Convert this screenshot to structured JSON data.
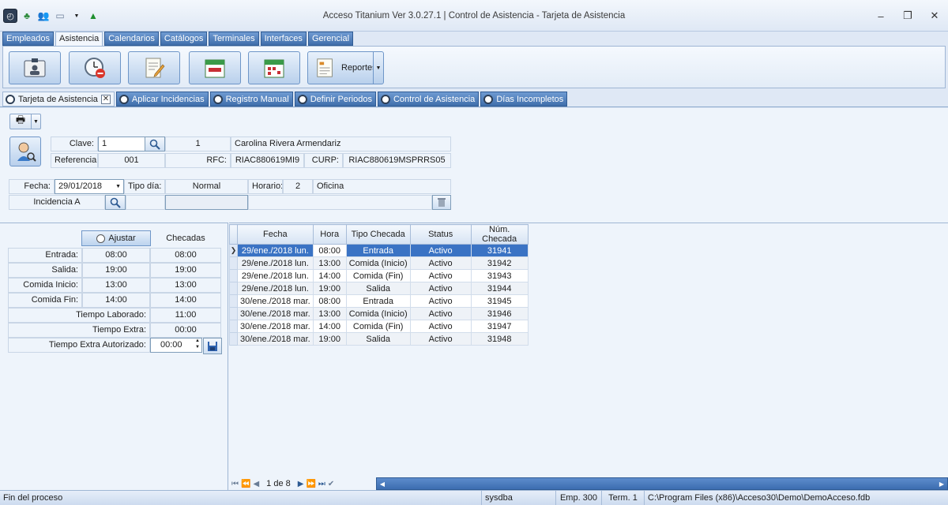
{
  "window": {
    "title": "Acceso Titanium  Ver 3.0.27.1 | Control de Asistencia - Tarjeta de Asistencia"
  },
  "main_tabs": [
    "Empleados",
    "Asistencia",
    "Calendarios",
    "Catálogos",
    "Terminales",
    "Interfaces",
    "Gerencial"
  ],
  "active_main_tab": "Asistencia",
  "ribbon": {
    "reportes_label": "Reportes"
  },
  "doc_tabs": [
    "Tarjeta de Asistencia",
    "Aplicar Incidencias",
    "Registro Manual",
    "Definir Periodos",
    "Control de Asistencia",
    "Días Incompletos"
  ],
  "employee": {
    "clave_label": "Clave:",
    "clave_value": "1",
    "id": "1",
    "name": "Carolina Rivera Armendariz",
    "referencia_label": "Referencia:",
    "referencia_value": "001",
    "rfc_label": "RFC:",
    "rfc_value": "RIAC880619MI9",
    "curp_label": "CURP:",
    "curp_value": "RIAC880619MSPRRS05"
  },
  "day": {
    "fecha_label": "Fecha:",
    "fecha_value": "29/01/2018",
    "tipo_dia_label": "Tipo día:",
    "tipo_dia_value": "Normal",
    "horario_label": "Horario:",
    "horario_num": "2",
    "horario_name": "Oficina",
    "incidencia_label": "Incidencia A"
  },
  "schedule": {
    "ajustar_label": "Ajustar",
    "checadas_header": "Checadas",
    "rows": [
      {
        "label": "Entrada:",
        "horario": "08:00",
        "checada": "08:00"
      },
      {
        "label": "Salida:",
        "horario": "19:00",
        "checada": "19:00"
      },
      {
        "label": "Comida Inicio:",
        "horario": "13:00",
        "checada": "13:00"
      },
      {
        "label": "Comida Fin:",
        "horario": "14:00",
        "checada": "14:00"
      }
    ],
    "tiempo_laborado_label": "Tiempo Laborado:",
    "tiempo_laborado_value": "11:00",
    "tiempo_extra_label": "Tiempo Extra:",
    "tiempo_extra_value": "00:00",
    "tiempo_extra_aut_label": "Tiempo Extra Autorizado:",
    "tiempo_extra_aut_value": "00:00"
  },
  "grid": {
    "columns": [
      "Fecha",
      "Hora",
      "Tipo Checada",
      "Status",
      "Núm. Checada"
    ],
    "rows": [
      [
        "29/ene./2018 lun.",
        "08:00",
        "Entrada",
        "Activo",
        "31941"
      ],
      [
        "29/ene./2018 lun.",
        "13:00",
        "Comida (Inicio)",
        "Activo",
        "31942"
      ],
      [
        "29/ene./2018 lun.",
        "14:00",
        "Comida (Fin)",
        "Activo",
        "31943"
      ],
      [
        "29/ene./2018 lun.",
        "19:00",
        "Salida",
        "Activo",
        "31944"
      ],
      [
        "30/ene./2018 mar.",
        "08:00",
        "Entrada",
        "Activo",
        "31945"
      ],
      [
        "30/ene./2018 mar.",
        "13:00",
        "Comida (Inicio)",
        "Activo",
        "31946"
      ],
      [
        "30/ene./2018 mar.",
        "14:00",
        "Comida (Fin)",
        "Activo",
        "31947"
      ],
      [
        "30/ene./2018 mar.",
        "19:00",
        "Salida",
        "Activo",
        "31948"
      ]
    ],
    "selected_row": 0,
    "pager": "1 de 8"
  },
  "statusbar": {
    "message": "Fin del proceso",
    "user": "sysdba",
    "emp": "Emp. 300",
    "term": "Term. 1",
    "path": "C:\\Program Files (x86)\\Acceso30\\Demo\\DemoAcceso.fdb"
  },
  "colors": {
    "tab_blue": "#3f6eab",
    "selection": "#3a73c4",
    "panel": "#eef4fb"
  }
}
